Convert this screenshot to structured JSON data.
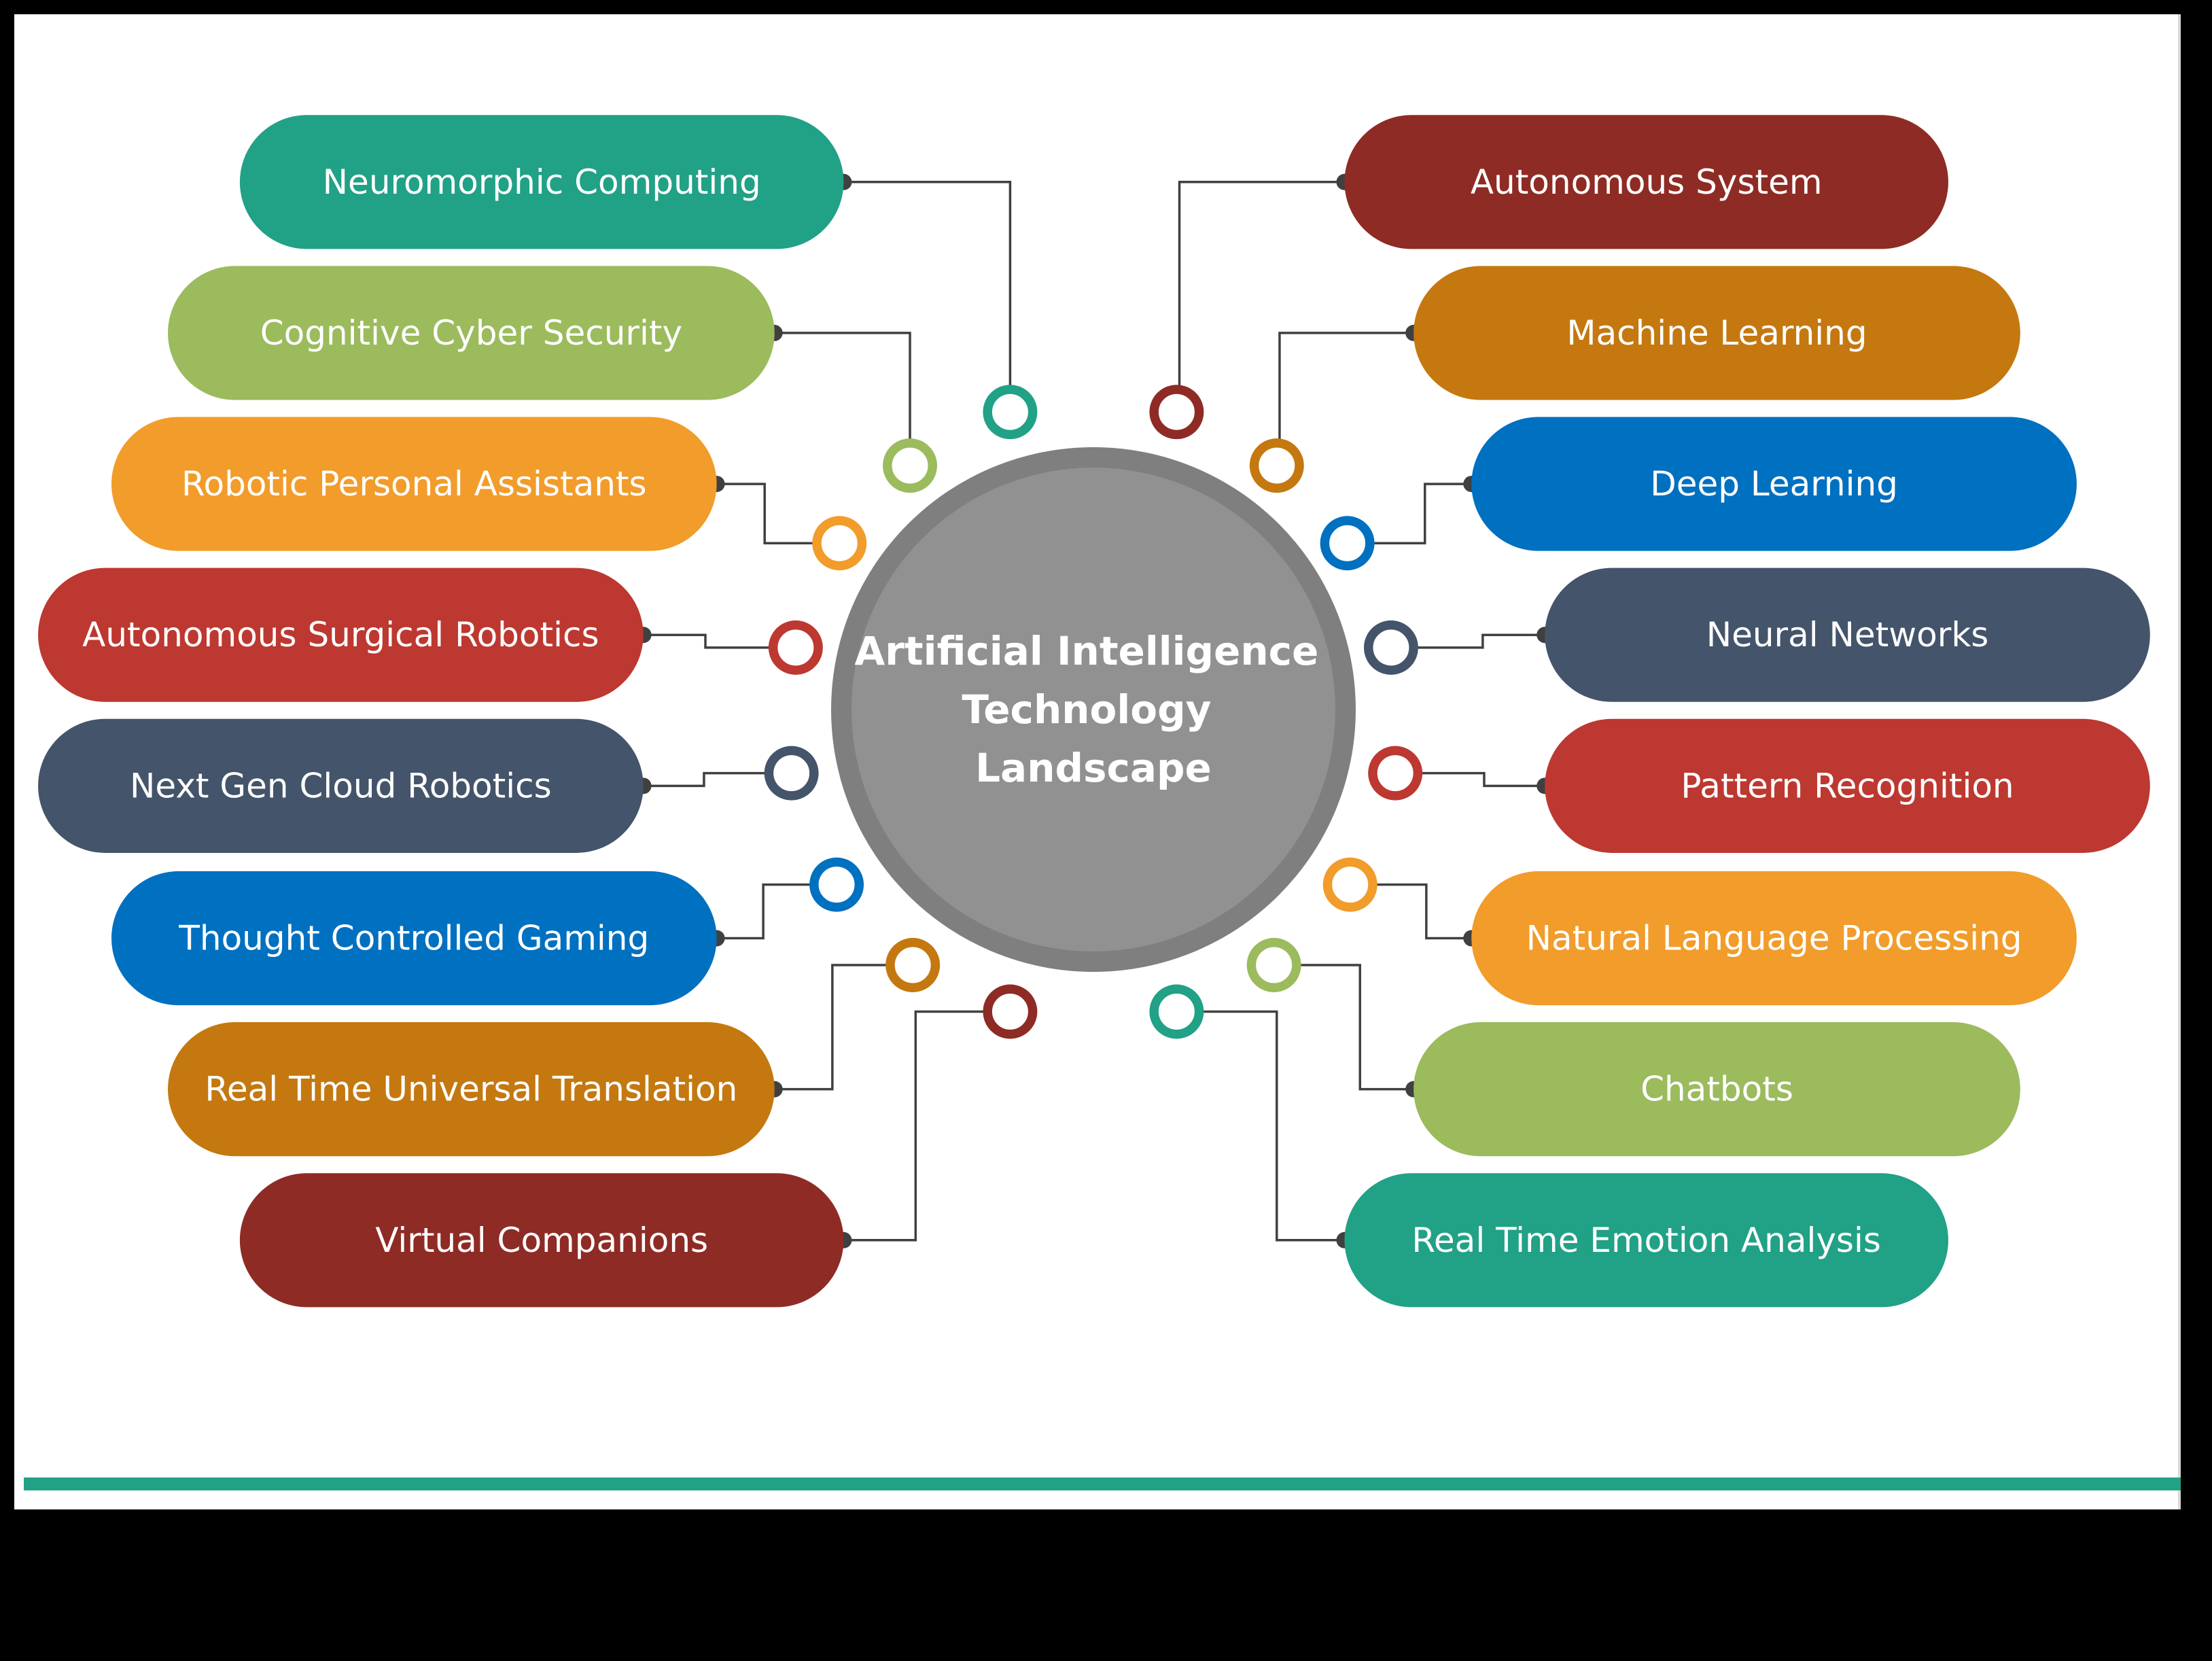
{
  "title": {
    "lines": [
      "Artificial Intelligence",
      "Technology",
      "Landscape"
    ]
  },
  "colors": {
    "center_ring": "#7f7f7f",
    "center_fill": "#919191",
    "connector": "#404040",
    "accent_bar": "#21a185",
    "panel": "#ffffff",
    "background": "#000000"
  },
  "left_items": [
    {
      "label": "Neuromorphic Computing",
      "color": "#21a185"
    },
    {
      "label": "Cognitive Cyber Security",
      "color": "#9bbb5d"
    },
    {
      "label": "Robotic Personal Assistants",
      "color": "#f19c2b"
    },
    {
      "label": "Autonomous Surgical Robotics",
      "color": "#bd3830"
    },
    {
      "label": "Next Gen Cloud Robotics",
      "color": "#44546a"
    },
    {
      "label": "Thought Controlled Gaming",
      "color": "#0070c0"
    },
    {
      "label": "Real Time Universal Translation",
      "color": "#c4780f"
    },
    {
      "label": "Virtual Companions",
      "color": "#8e2b25"
    }
  ],
  "right_items": [
    {
      "label": "Autonomous System",
      "color": "#8e2b25"
    },
    {
      "label": "Machine Learning",
      "color": "#c4780f"
    },
    {
      "label": "Deep Learning",
      "color": "#0070c0"
    },
    {
      "label": "Neural Networks",
      "color": "#44546a"
    },
    {
      "label": "Pattern Recognition",
      "color": "#bd3830"
    },
    {
      "label": "Natural Language Processing",
      "color": "#f19c2b"
    },
    {
      "label": "Chatbots",
      "color": "#9bbb5d"
    },
    {
      "label": "Real Time Emotion Analysis",
      "color": "#21a185"
    }
  ]
}
